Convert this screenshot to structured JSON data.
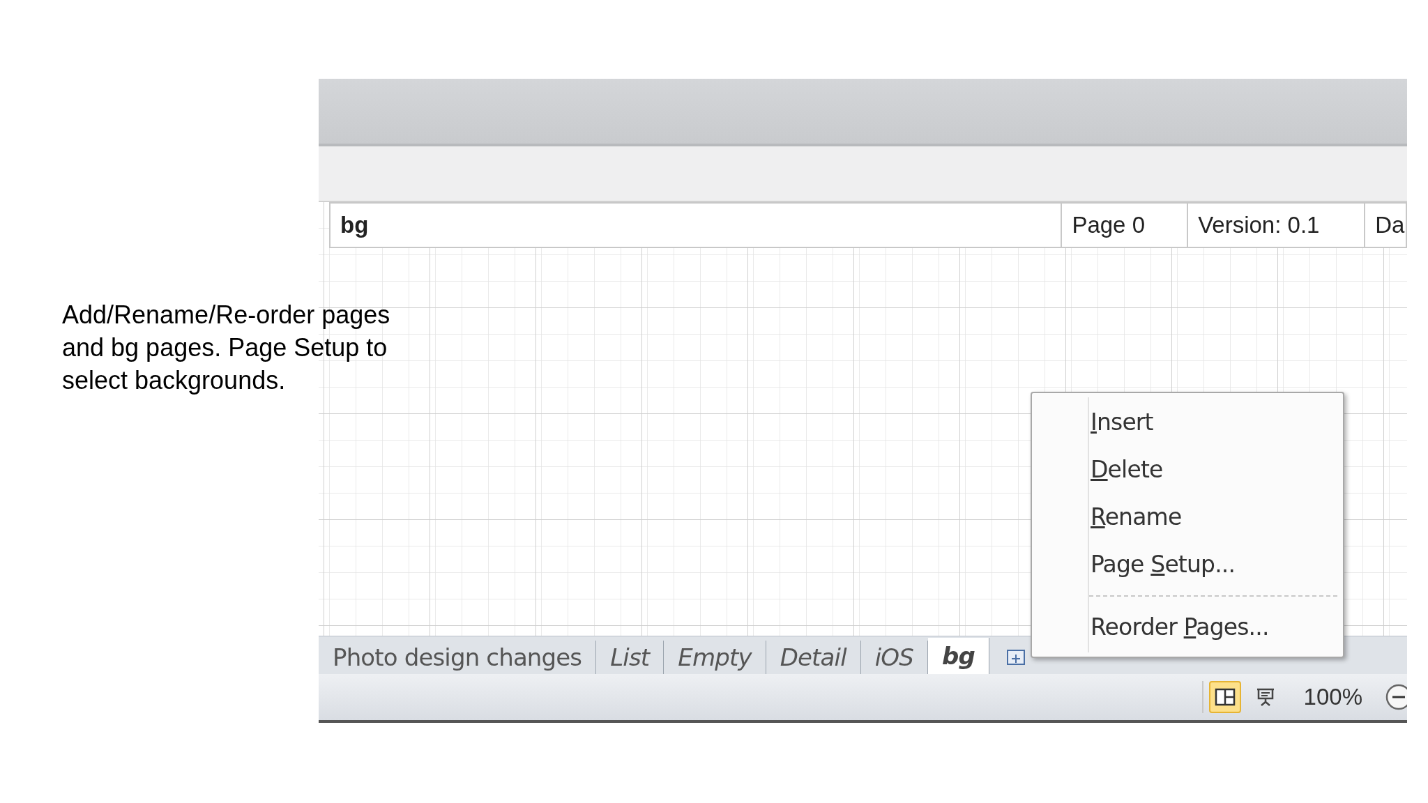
{
  "caption": "Add/Rename/Re-order pages and bg pages. Page Setup to select backgrounds.",
  "title_block": [
    "bg",
    "Page 0",
    "Version: 0.1",
    "Da"
  ],
  "page_tabs": [
    {
      "label": "Photo design changes",
      "kind": "foreground",
      "selected": false
    },
    {
      "label": "List",
      "kind": "background",
      "selected": false
    },
    {
      "label": "Empty",
      "kind": "background",
      "selected": false
    },
    {
      "label": "Detail",
      "kind": "background",
      "selected": false
    },
    {
      "label": "iOS",
      "kind": "background",
      "selected": false
    },
    {
      "label": "bg",
      "kind": "background",
      "selected": true
    }
  ],
  "context_menu": [
    {
      "key": "I",
      "post": "nsert",
      "kind": "item"
    },
    {
      "key": "D",
      "post": "elete",
      "kind": "item"
    },
    {
      "key": "R",
      "post": "ename",
      "kind": "item"
    },
    {
      "pre": "Page ",
      "key": "S",
      "post": "etup...",
      "kind": "item"
    },
    {
      "kind": "separator"
    },
    {
      "pre": "Reorder ",
      "key": "P",
      "post": "ages...",
      "kind": "item"
    }
  ],
  "status_bar": {
    "views": [
      {
        "kind": "full_page",
        "selected": true
      },
      {
        "kind": "presentation",
        "selected": false
      }
    ],
    "zoom": "100%"
  }
}
